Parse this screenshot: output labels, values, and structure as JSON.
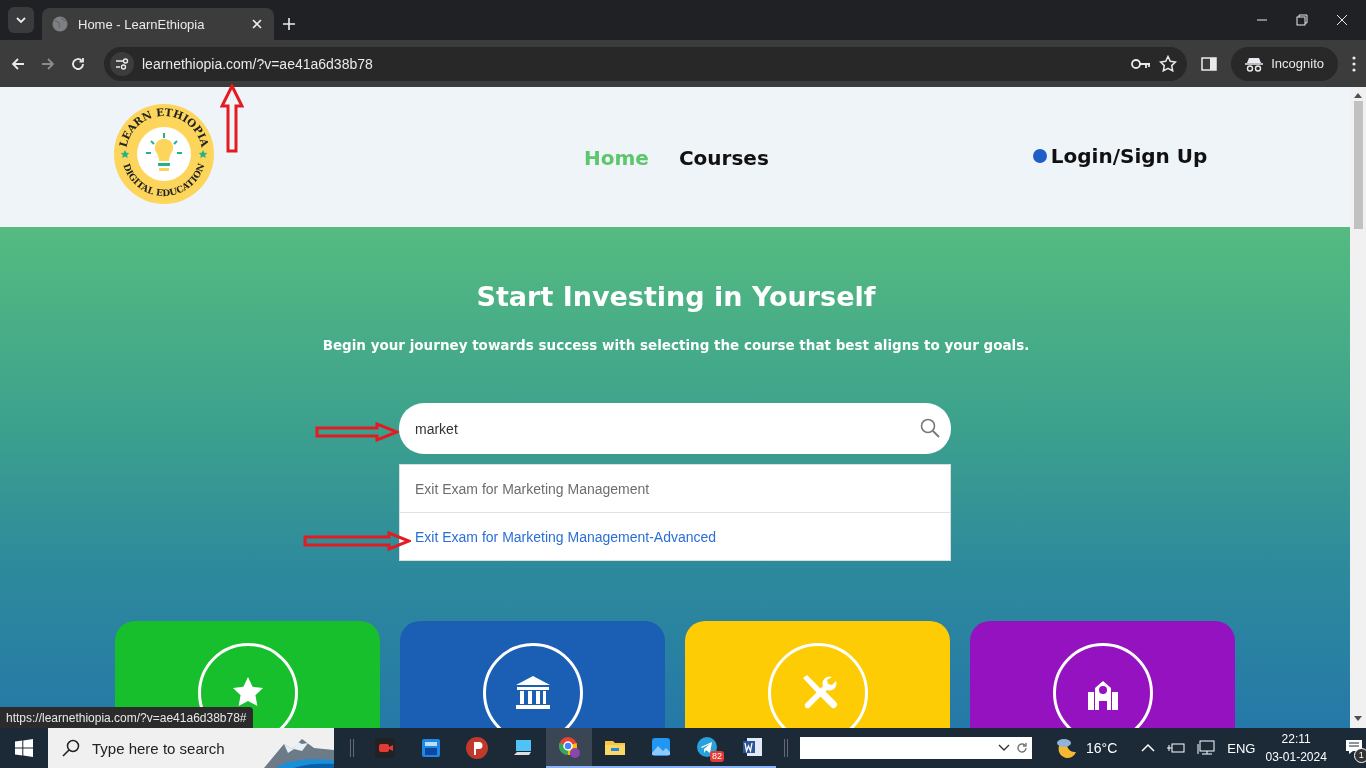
{
  "browser": {
    "tab_title": "Home - LearnEthiopia",
    "url": "learnethiopia.com/?v=ae41a6d38b78",
    "profile": "Incognito",
    "status_url": "https://learnethiopia.com/?v=ae41a6d38b78#"
  },
  "header": {
    "logo_top": "LEARN ETHIOPIA",
    "logo_bottom": "DIGITAL EDUCATION",
    "nav": [
      {
        "label": "Home",
        "selected": true
      },
      {
        "label": "Courses",
        "selected": false
      }
    ],
    "login": "Login/Sign Up"
  },
  "hero": {
    "title": "Start Investing in Yourself",
    "subtitle": "Begin your journey towards success with selecting the course that best aligns to your goals.",
    "search": {
      "value": "market"
    },
    "suggestions": [
      {
        "label": "Exit Exam for Marketing Management",
        "selected": false
      },
      {
        "label": "Exit Exam for Marketing Management-Advanced",
        "selected": true
      }
    ]
  },
  "categories": [
    {
      "kind": "star",
      "color": "#17bf2c"
    },
    {
      "kind": "bank",
      "color": "#1a5fb4"
    },
    {
      "kind": "tools",
      "color": "#fdcc05"
    },
    {
      "kind": "school",
      "color": "#9412bf"
    }
  ],
  "taskbar": {
    "search_placeholder": "Type here to search",
    "telegram_badge": "82",
    "temperature": "16°C",
    "language": "ENG",
    "time": "22:11",
    "date": "03-01-2024",
    "notifications": "1"
  }
}
